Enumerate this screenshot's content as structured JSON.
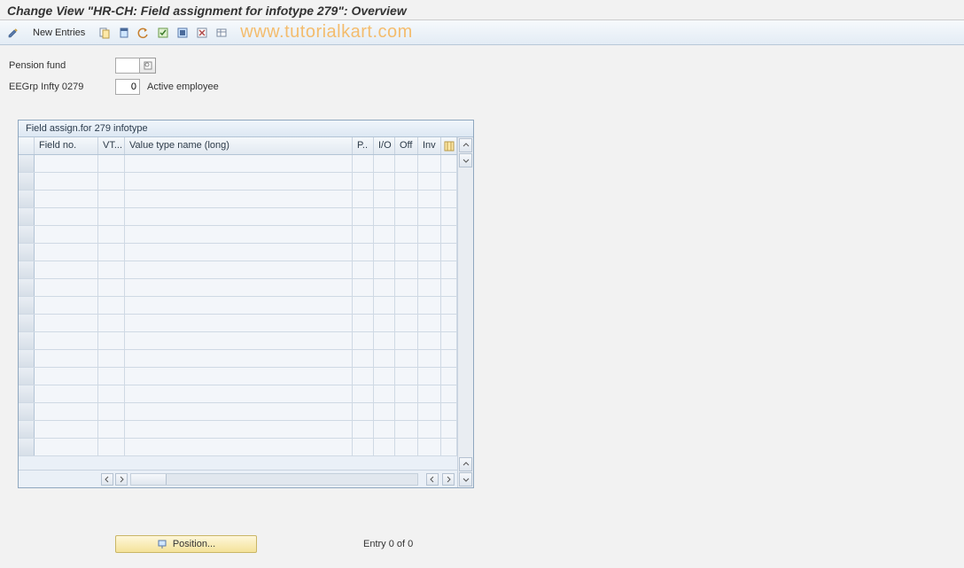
{
  "title": "Change View \"HR-CH: Field assignment for infotype 279\": Overview",
  "toolbar": {
    "new_entries_label": "New Entries"
  },
  "watermark": "www.tutorialkart.com",
  "form": {
    "pension_fund_label": "Pension fund",
    "pension_fund_value": "",
    "eegrp_label": "EEGrp Infty 0279",
    "eegrp_value": "0",
    "eegrp_desc": "Active employee"
  },
  "table": {
    "panel_title": "Field assign.for 279 infotype",
    "columns": {
      "field_no": "Field no.",
      "vt": "VT...",
      "vt_name": "Value type name (long)",
      "p": "P..",
      "io": "I/O",
      "off": "Off",
      "inv": "Inv"
    },
    "rows": []
  },
  "footer": {
    "position_label": "Position...",
    "entry_text": "Entry 0 of 0"
  }
}
